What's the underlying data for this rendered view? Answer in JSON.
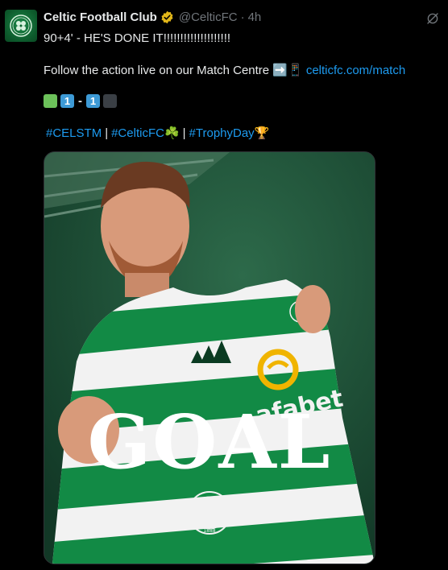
{
  "tweet": {
    "name": "Celtic Football Club",
    "handle": "@CelticFC",
    "separator": "·",
    "time": "4h",
    "line1": "90+4' -  HE'S DONE IT!!!!!!!!!!!!!!!!!!!!",
    "line2_prefix": "Follow the action live on our Match Centre ➡️📱 ",
    "link": "celticfc.com/match",
    "score": {
      "home": "1",
      "dash": "-",
      "away": "1"
    },
    "hashtags": [
      "#CELSTM",
      "#CelticFC☘️",
      "#TrophyDay🏆"
    ],
    "tag_separator": "|"
  },
  "media": {
    "overlay_text": "GOAL",
    "sponsor": "afabet",
    "crest_year": "1888"
  },
  "colors": {
    "background": "#000000",
    "link": "#1d9bf0",
    "celtic_green": "#0f8a45",
    "hoop_white": "#f2f2f2"
  },
  "icons": [
    "verified-badge-icon",
    "grok-icon",
    "club-crest-icon",
    "four-leaf-clover-icon"
  ]
}
